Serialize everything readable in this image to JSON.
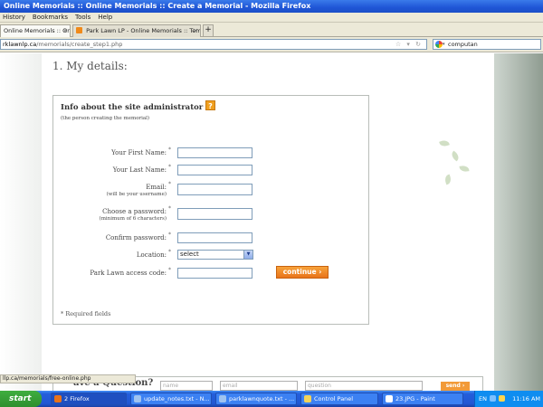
{
  "window": {
    "title": "Online Memorials :: Online Memorials :: Create a Memorial - Mozilla Firefox"
  },
  "menu": [
    "History",
    "Bookmarks",
    "Tools",
    "Help"
  ],
  "tabs": [
    {
      "label": "Online Memorials :: Online...",
      "active": true
    },
    {
      "label": "Park Lawn LP - Online Memorials :: Templ...",
      "active": false
    }
  ],
  "nav": {
    "url_domain": "rklawnlp.ca",
    "url_path": "/memorials/create_step1.php",
    "search_value": "computan"
  },
  "page": {
    "step_title": "1. My details:",
    "panel_heading": "Info about the site administrator",
    "panel_subheading": "(the person creating the memorial)",
    "fields": [
      {
        "label": "Your First Name:",
        "sub": ""
      },
      {
        "label": "Your Last Name:",
        "sub": ""
      },
      {
        "label": "Email:",
        "sub": "(will be your username)"
      },
      {
        "label": "Choose a password:",
        "sub": "(minimum of 6 characters)"
      },
      {
        "label": "Confirm password:",
        "sub": ""
      },
      {
        "label": "Location:",
        "sub": ""
      },
      {
        "label": "Park Lawn access code:",
        "sub": ""
      }
    ],
    "required_marker": "*",
    "location_selected": "select",
    "continue_label": "continue",
    "required_note": "* Required fields",
    "question_title": "ave a Question?",
    "question_placeholders": {
      "name": "name",
      "email": "email",
      "question": "question"
    },
    "question_send": "send"
  },
  "status_bar": "llp.ca/memorials/free-online.php",
  "taskbar": {
    "start": "start",
    "items": [
      {
        "label": "2 Firefox",
        "color": "#e8731a",
        "active": true
      },
      {
        "label": "update_notes.txt - N...",
        "color": "#9fc3f0",
        "active": false
      },
      {
        "label": "parklawnquote.txt - ...",
        "color": "#9fc3f0",
        "active": false
      },
      {
        "label": "Control Panel",
        "color": "#f3d35a",
        "active": false
      },
      {
        "label": "23.JPG - Paint",
        "color": "#ffffff",
        "active": false
      }
    ],
    "lang": "EN",
    "clock": "11:16 AM"
  }
}
